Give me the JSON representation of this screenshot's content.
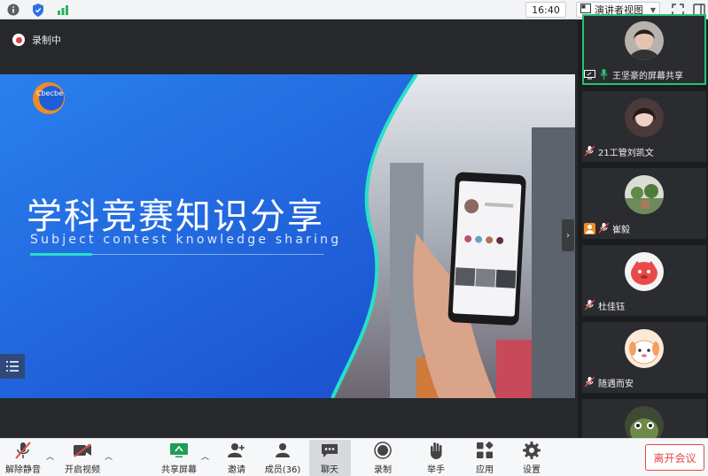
{
  "topbar": {
    "icons": [
      "info-icon",
      "shield-icon",
      "signal-icon"
    ],
    "clock": "16:40",
    "view_mode": "演讲者视图",
    "right_icons": [
      "fullscreen-icon",
      "window-icon"
    ]
  },
  "share": {
    "recording_label": "录制中",
    "slide": {
      "logo_text": "Cbecbe",
      "title": "学科竞赛知识分享",
      "subtitle": "Subject contest knowledge sharing"
    }
  },
  "participants": [
    {
      "name": "王坚豪的屏幕共享",
      "status": "sharing",
      "avatar": "woman-photo"
    },
    {
      "name": "21工管刘凯文",
      "status": "muted",
      "avatar": "woman-photo"
    },
    {
      "name": "崔毅",
      "status": "muted",
      "avatar": "plant-photo"
    },
    {
      "name": "杜佳钰",
      "status": "muted",
      "avatar": "cartoon-red"
    },
    {
      "name": "随遇而安",
      "status": "muted",
      "avatar": "cartoon-dog"
    },
    {
      "name": "",
      "status": "",
      "avatar": "cartoon-frog"
    }
  ],
  "toolbar": {
    "unmute": "解除静音",
    "start_video": "开启视频",
    "share_screen": "共享屏幕",
    "invite": "邀请",
    "members": "成员(36)",
    "chat": "聊天",
    "record": "录制",
    "raise_hand": "举手",
    "apps": "应用",
    "settings": "设置",
    "leave": "离开会议"
  },
  "colors": {
    "accent_green": "#27c07a",
    "leave_red": "#e04848",
    "slide_blue": "#1e63e0",
    "slide_teal": "#27e0c8"
  }
}
